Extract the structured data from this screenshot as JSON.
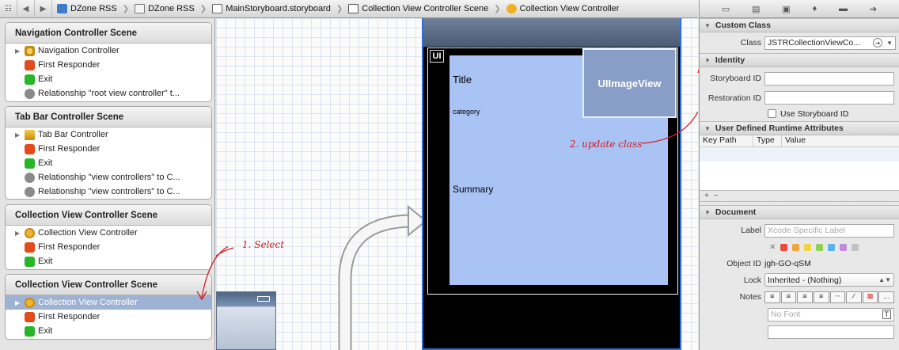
{
  "breadcrumb": [
    "DZone RSS",
    "DZone RSS",
    "MainStoryboard.storyboard",
    "Collection View Controller Scene",
    "Collection View Controller"
  ],
  "outline": {
    "scenes": [
      {
        "title": "Navigation Controller Scene",
        "rows": [
          "Navigation Controller",
          "First Responder",
          "Exit",
          "Relationship \"root view controller\" t..."
        ]
      },
      {
        "title": "Tab Bar Controller Scene",
        "rows": [
          "Tab Bar Controller",
          "First Responder",
          "Exit",
          "Relationship \"view controllers\" to C...",
          "Relationship \"view controllers\" to C..."
        ]
      },
      {
        "title": "Collection View Controller Scene",
        "rows": [
          "Collection View Controller",
          "First Responder",
          "Exit"
        ]
      },
      {
        "title": "Collection View Controller Scene",
        "rows": [
          "Collection View Controller",
          "First Responder",
          "Exit"
        ]
      }
    ]
  },
  "canvas": {
    "badge": "UI",
    "title": "Title",
    "category": "category",
    "summary": "Summary",
    "imageview": "UIImageView",
    "annot_select": "1. Select",
    "annot_update": "2. update class"
  },
  "inspector": {
    "custom_class": {
      "header": "Custom Class",
      "class_label": "Class",
      "class_value": "JSTRCollectionViewCo..."
    },
    "identity": {
      "header": "Identity",
      "storyboard_id_label": "Storyboard ID",
      "restoration_id_label": "Restoration ID",
      "use_storyboard_id": "Use Storyboard ID"
    },
    "runtime": {
      "header": "User Defined Runtime Attributes",
      "columns": [
        "Key Path",
        "Type",
        "Value"
      ]
    },
    "document": {
      "header": "Document",
      "label_label": "Label",
      "label_placeholder": "Xcode Specific Label",
      "object_id_label": "Object ID",
      "object_id": "jgh-GO-qSM",
      "lock_label": "Lock",
      "lock_value": "Inherited - (Nothing)",
      "notes_label": "Notes",
      "font_placeholder": "No Font"
    },
    "label_colors": [
      "#e84b3c",
      "#f5a43a",
      "#f2d33c",
      "#8ed14f",
      "#56b3f0",
      "#c389e0",
      "#c2c2c2"
    ]
  }
}
